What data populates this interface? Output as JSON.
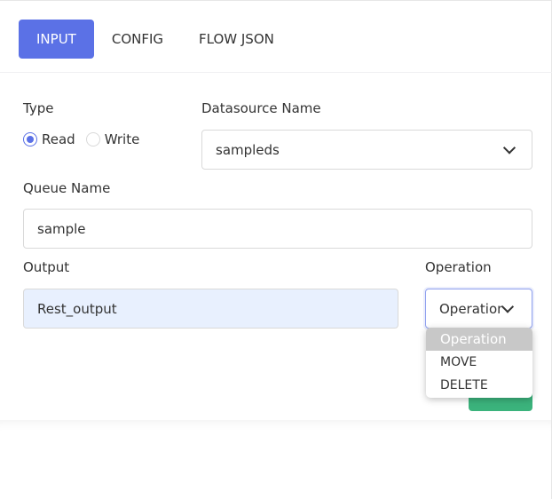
{
  "tabs": [
    {
      "label": "INPUT",
      "active": true
    },
    {
      "label": "CONFIG",
      "active": false
    },
    {
      "label": "FLOW JSON",
      "active": false
    }
  ],
  "form": {
    "type": {
      "label": "Type",
      "options": [
        {
          "label": "Read",
          "checked": true
        },
        {
          "label": "Write",
          "checked": false
        }
      ]
    },
    "datasource": {
      "label": "Datasource Name",
      "value": "sampleds"
    },
    "queue": {
      "label": "Queue Name",
      "value": "sample"
    },
    "output": {
      "label": "Output",
      "value": "Rest_output"
    },
    "operation": {
      "label": "Operation",
      "value": "Operation",
      "options": [
        "Operation",
        "MOVE",
        "DELETE"
      ]
    }
  },
  "colors": {
    "accent": "#5b71e6",
    "submit": "#3bb37c",
    "output_bg": "#e8f0fe"
  }
}
